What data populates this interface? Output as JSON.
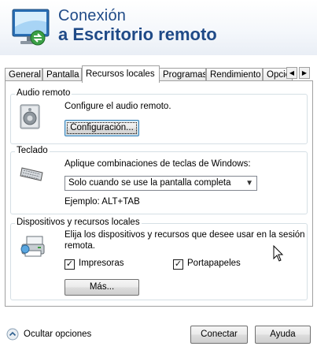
{
  "header": {
    "title_line1": "Conexión",
    "title_line2": "a Escritorio remoto"
  },
  "tabs": [
    {
      "label": "General",
      "active": false
    },
    {
      "label": "Pantalla",
      "active": false
    },
    {
      "label": "Recursos locales",
      "active": true
    },
    {
      "label": "Programas",
      "active": false
    },
    {
      "label": "Rendimiento",
      "active": false
    },
    {
      "label": "Opcio",
      "active": false
    }
  ],
  "audio": {
    "group_label": "Audio remoto",
    "description": "Configure el audio remoto.",
    "button_label": "Configuración..."
  },
  "keyboard": {
    "group_label": "Teclado",
    "description": "Aplique combinaciones de teclas de Windows:",
    "select_value": "Solo cuando se use la pantalla completa",
    "example": "Ejemplo: ALT+TAB"
  },
  "devices": {
    "group_label": "Dispositivos y recursos locales",
    "description_line1": "Elija los dispositivos y recursos que desee usar en la sesión",
    "description_line2": "remota.",
    "printers_label": "Impresoras",
    "printers_checked": true,
    "clipboard_label": "Portapapeles",
    "clipboard_checked": true,
    "more_button_label": "Más..."
  },
  "footer": {
    "hide_options_label": "Ocultar opciones",
    "connect_label": "Conectar",
    "help_label": "Ayuda"
  },
  "colors": {
    "title": "#1f4a87",
    "button_focus_border": "#3c7fb1"
  }
}
